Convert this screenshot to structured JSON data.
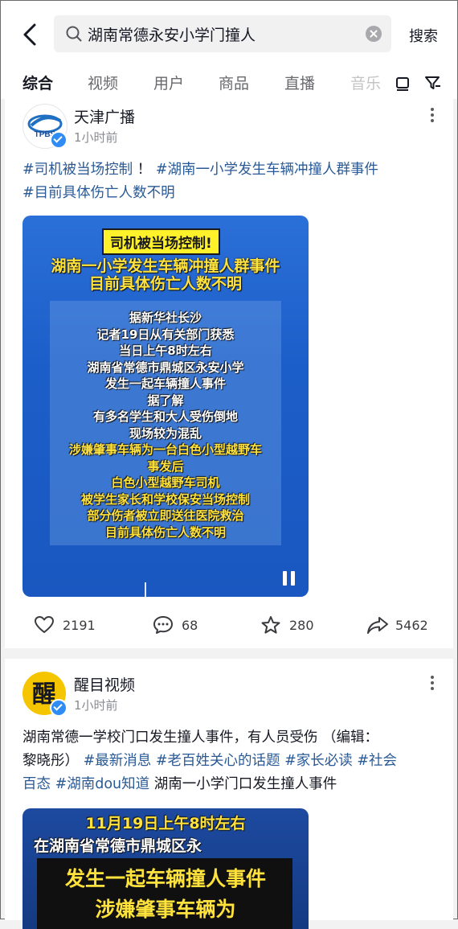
{
  "search": {
    "query": "湖南常德永安小学门撞人",
    "submit_label": "搜索"
  },
  "tabs": [
    "综合",
    "视频",
    "用户",
    "商品",
    "直播",
    "音乐"
  ],
  "posts": [
    {
      "author": "天津广播",
      "avatar_text": "TPBS",
      "time": "1小时前",
      "desc_tags": [
        "#司机被当场控制",
        "#湖南一小学发生车辆冲撞人群事件",
        "#目前具体伤亡人数不明"
      ],
      "desc_sep": " ！",
      "video": {
        "header": "司机被当场控制!",
        "title_lines": [
          "湖南一小学发生车辆冲撞人群事件",
          "目前具体伤亡人数不明"
        ],
        "body_lines": [
          "据新华社长沙",
          "记者19日从有关部门获悉",
          "当日上午8时左右",
          "湖南省常德市鼎城区永安小学",
          "发生一起车辆撞人事件",
          "据了解",
          "有多名学生和大人受伤倒地",
          "现场较为混乱",
          "涉嫌肇事车辆为一台白色小型越野车",
          "事发后",
          "白色小型越野车司机",
          "被学生家长和学校保安当场控制",
          "部分伤者被立即送往医院救治",
          "目前具体伤亡人数不明"
        ]
      },
      "stats": {
        "likes": "2191",
        "comments": "68",
        "favorites": "280",
        "shares": "5462"
      }
    },
    {
      "author": "醒目视频",
      "avatar_text": "醒",
      "time": "1小时前",
      "desc_plain1": "湖南常德一学校门口发生撞人事件，有人员受伤 （编辑：",
      "desc_plain2": "黎晓彤）",
      "desc_tags": [
        "#最新消息",
        "#老百姓关心的话题",
        "#家长必读",
        "#社会",
        "百态",
        "#湖南dou知道"
      ],
      "desc_tail": "湖南一小学门口发生撞人事件",
      "video": {
        "line1": "11月19日上午8时左右",
        "line2": "在湖南省常德市鼎城区永",
        "line3": "发生一起车辆撞人事件",
        "line4": "涉嫌肇事车辆为"
      }
    }
  ]
}
